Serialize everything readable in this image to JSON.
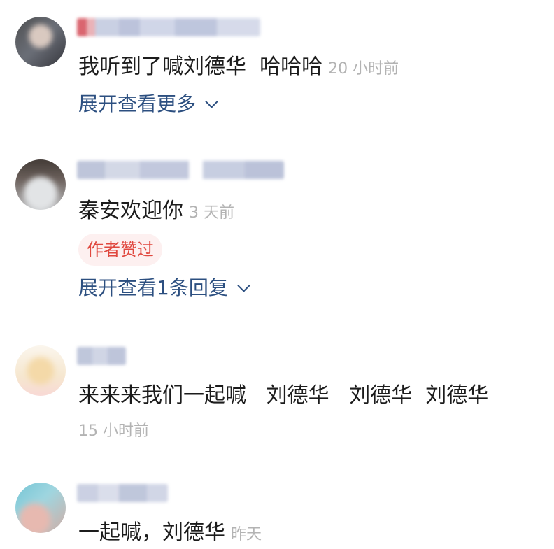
{
  "comments": [
    {
      "text": "我听到了喊刘德华  哈哈哈",
      "time": "20 小时前",
      "expand_label": "展开查看更多"
    },
    {
      "text": "秦安欢迎你",
      "time": "3 天前",
      "badge": "作者赞过",
      "expand_label": "展开查看1条回复"
    },
    {
      "text": "来来来我们一起喊   刘德华   刘德华  刘德华",
      "time": "15 小时前"
    },
    {
      "text": "一起喊，刘德华",
      "time": "昨天"
    }
  ],
  "colors": {
    "link": "#2c4f80",
    "badge_text": "#e0483f",
    "badge_bg": "#fdf0f0",
    "time": "#b3b3b3"
  }
}
